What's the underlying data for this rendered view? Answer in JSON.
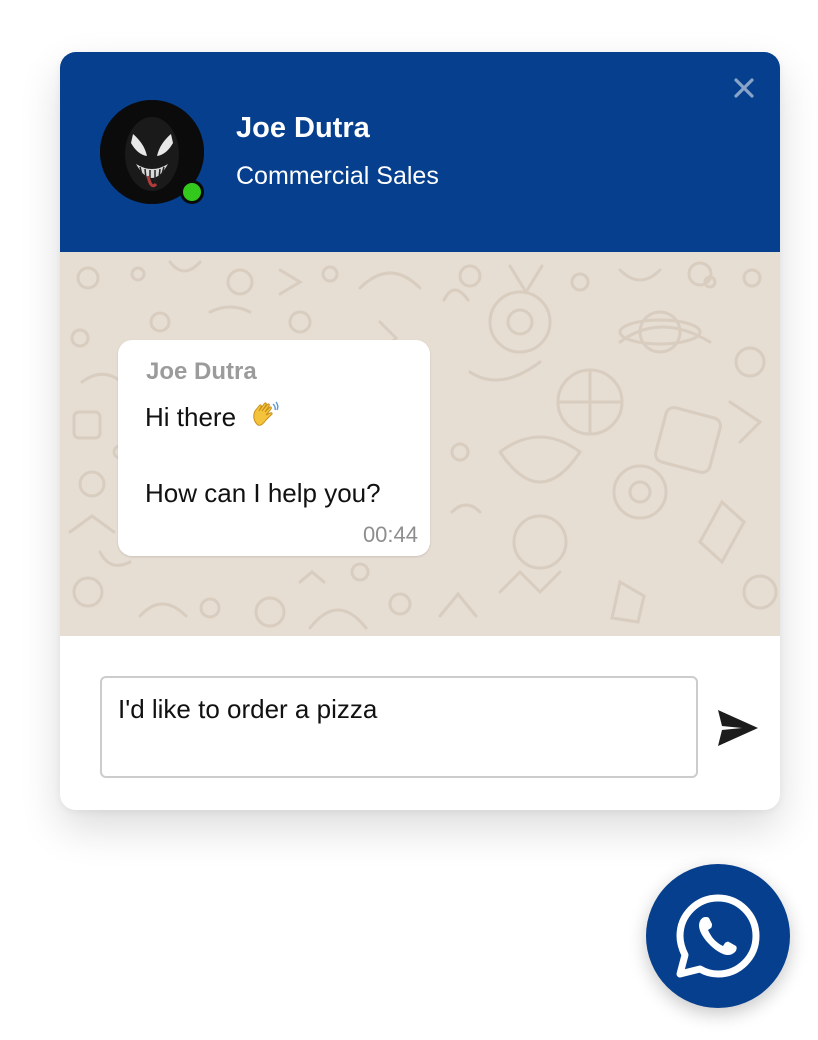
{
  "header": {
    "agent_name": "Joe Dutra",
    "agent_role": "Commercial Sales",
    "status": "online",
    "accent_color": "#053f8d",
    "status_color": "#33c81c",
    "close_icon": "close-icon"
  },
  "message": {
    "sender": "Joe Dutra",
    "line1": "Hi there",
    "emoji_icon": "waving-hand-icon",
    "line2": "How can I help you?",
    "time": "00:44"
  },
  "composer": {
    "input_value": "I'd like to order a pizza",
    "send_icon": "send-icon"
  },
  "launcher": {
    "icon": "whatsapp-icon"
  }
}
